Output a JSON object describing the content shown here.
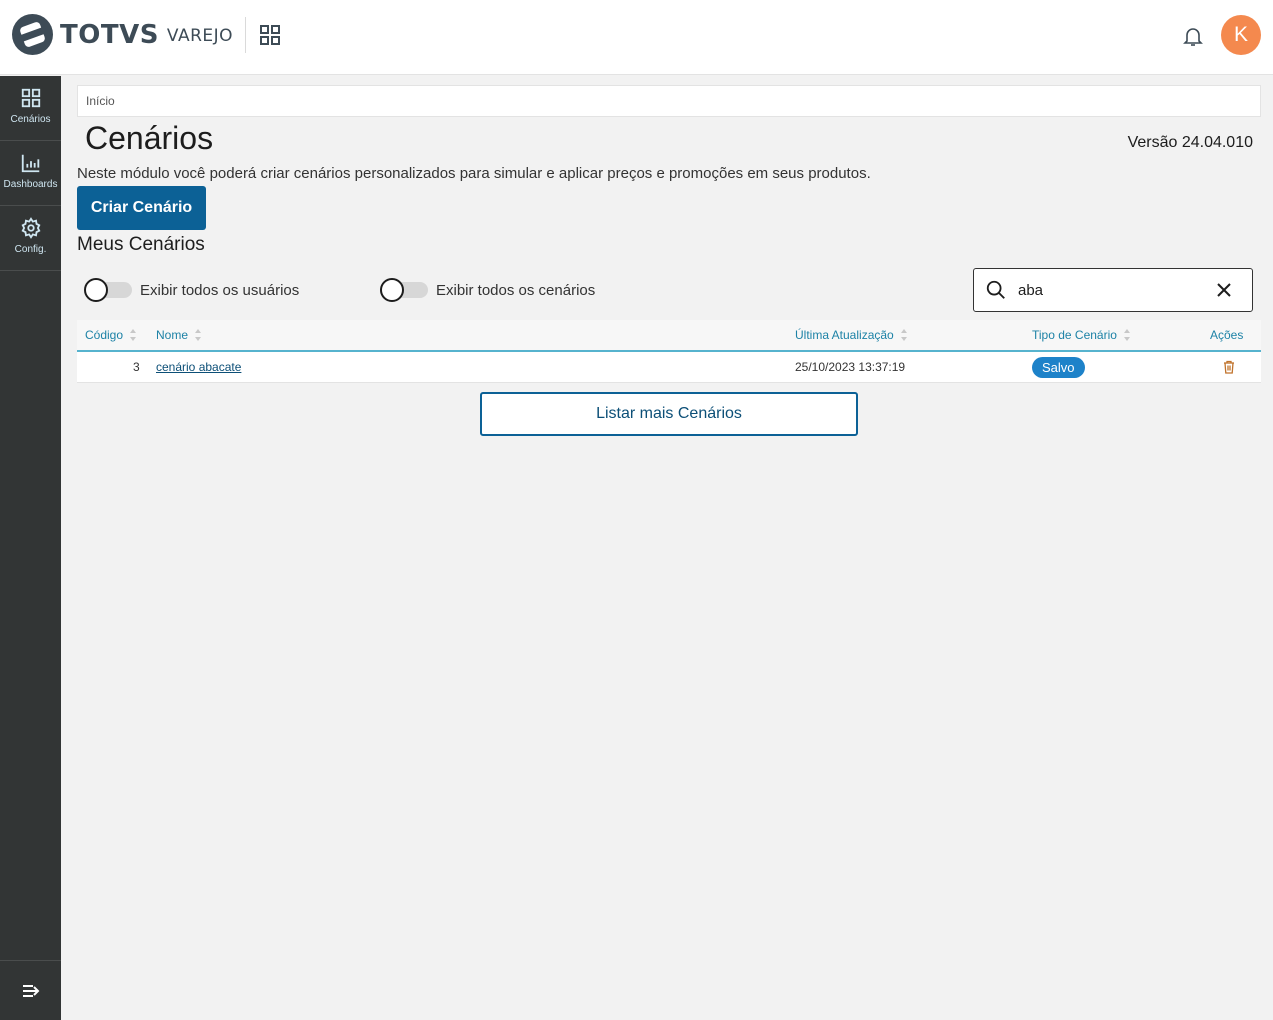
{
  "header": {
    "brand_name": "TOTVS",
    "brand_sub": "VAREJO",
    "avatar_initial": "K",
    "avatar_color": "#f4894e"
  },
  "sidebar": {
    "items": [
      {
        "label": "Cenários",
        "icon": "grid-icon"
      },
      {
        "label": "Dashboards",
        "icon": "bar-chart-icon"
      },
      {
        "label": "Config.",
        "icon": "gear-icon"
      }
    ],
    "collapse_icon": "collapse-menu-icon"
  },
  "breadcrumb": "Início",
  "page": {
    "title": "Cenários",
    "version": "Versão 24.04.010",
    "description": "Neste módulo você poderá criar cenários personalizados para simular e aplicar preços e promoções em seus produtos.",
    "create_button": "Criar Cenário",
    "section_title": "Meus Cenários"
  },
  "filters": {
    "toggle_users": {
      "label": "Exibir todos os usuários",
      "checked": false
    },
    "toggle_scenarios": {
      "label": "Exibir todos os cenários",
      "checked": false
    },
    "search_value": "aba"
  },
  "table": {
    "columns": [
      "Código",
      "Nome",
      "Última Atualização",
      "Tipo de Cenário",
      "Ações"
    ],
    "rows": [
      {
        "code": "3",
        "name": "cenário abacate",
        "updated": "25/10/2023 13:37:19",
        "type": "Salvo"
      }
    ]
  },
  "load_more": "Listar mais Cenários",
  "colors": {
    "primary": "#0c6196",
    "sidebar": "#323535",
    "table_header_text": "#1d82a6",
    "badge": "#1d82c9"
  }
}
